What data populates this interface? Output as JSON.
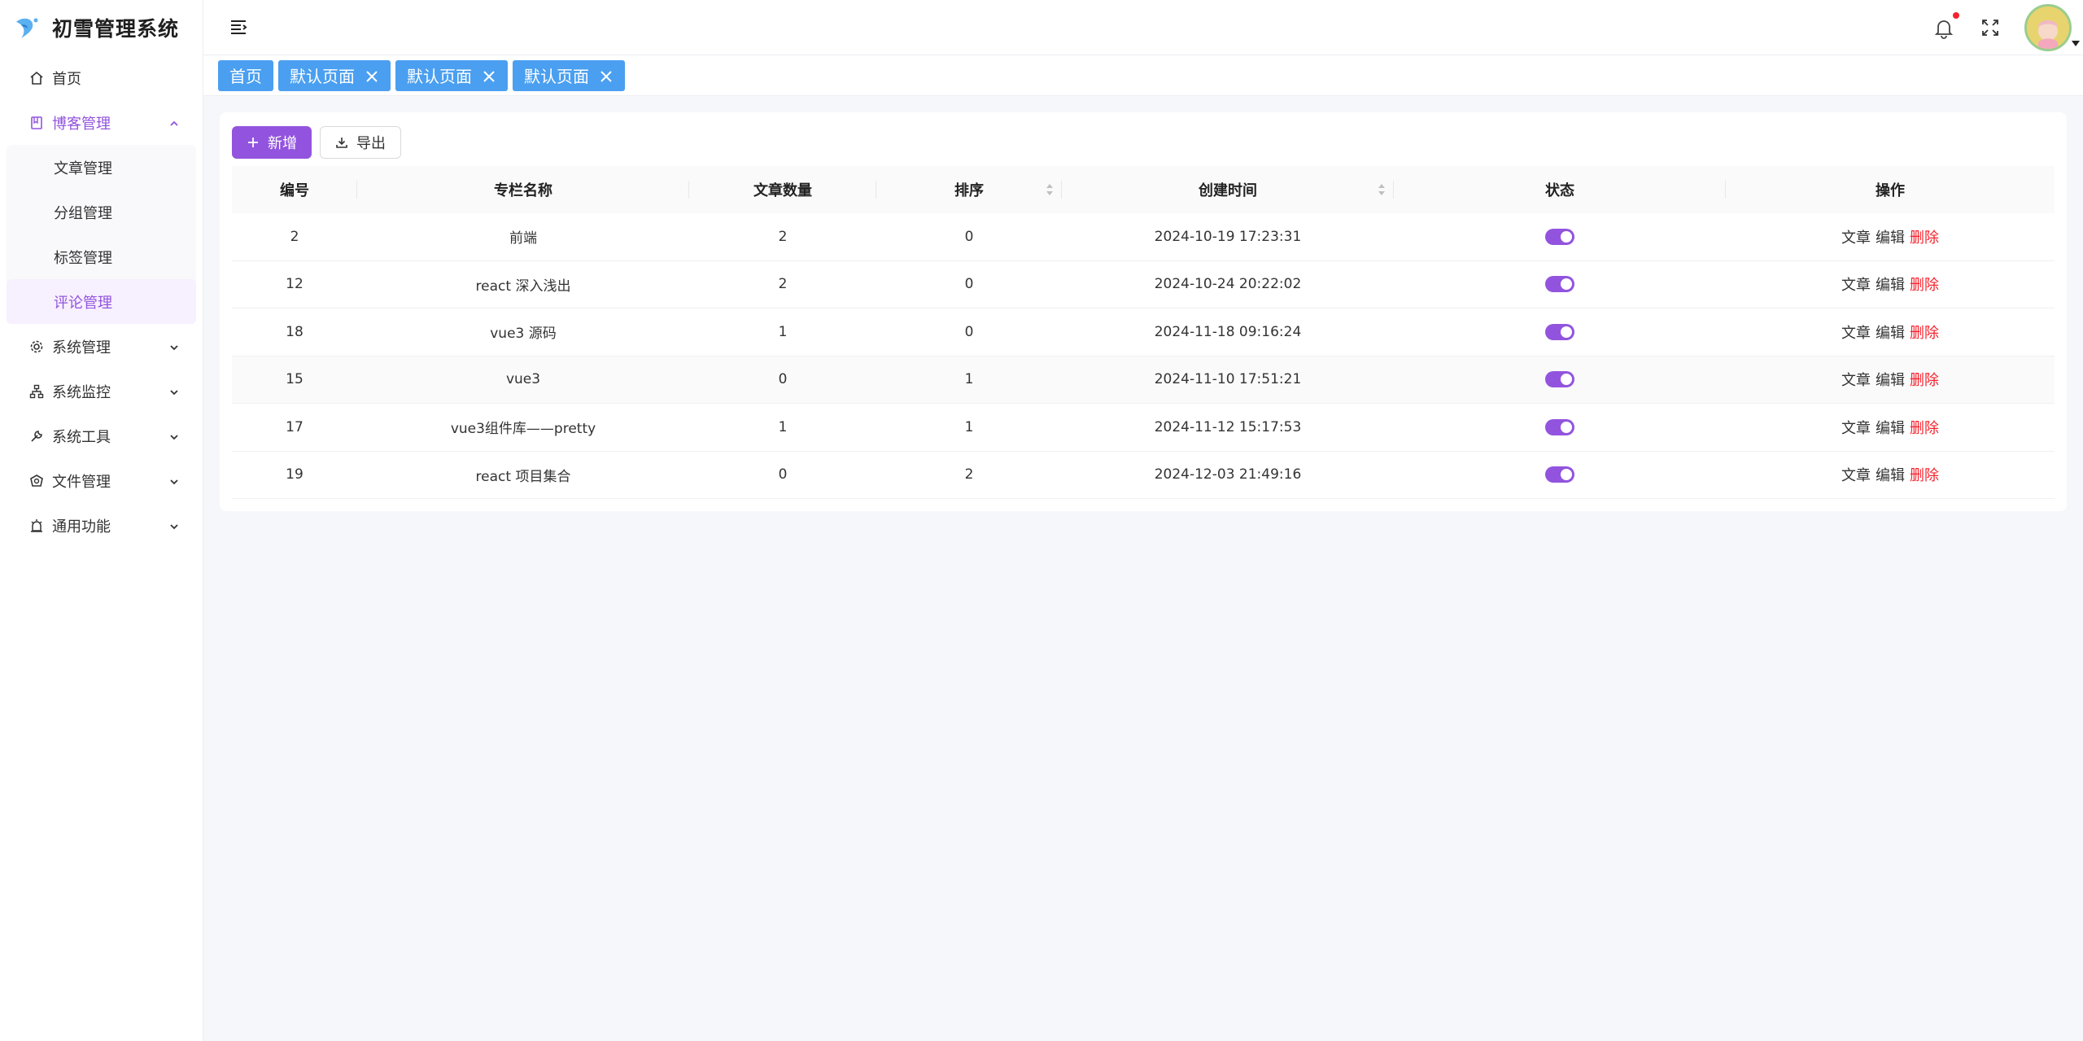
{
  "app": {
    "title": "初雪管理系统"
  },
  "sidebar": {
    "items": [
      {
        "label": "首页",
        "icon": "home-icon"
      },
      {
        "label": "博客管理",
        "icon": "book-icon",
        "expanded": true,
        "children": [
          {
            "label": "文章管理"
          },
          {
            "label": "分组管理"
          },
          {
            "label": "标签管理"
          },
          {
            "label": "评论管理",
            "active": true
          }
        ]
      },
      {
        "label": "系统管理",
        "icon": "gear-icon"
      },
      {
        "label": "系统监控",
        "icon": "network-icon"
      },
      {
        "label": "系统工具",
        "icon": "wrench-icon"
      },
      {
        "label": "文件管理",
        "icon": "folder-icon"
      },
      {
        "label": "通用功能",
        "icon": "alarm-icon"
      }
    ]
  },
  "tags": [
    {
      "label": "首页",
      "closable": false
    },
    {
      "label": "默认页面",
      "closable": true
    },
    {
      "label": "默认页面",
      "closable": true
    },
    {
      "label": "默认页面",
      "closable": true
    }
  ],
  "toolbar": {
    "add_label": "新增",
    "export_label": "导出"
  },
  "table": {
    "columns": [
      "编号",
      "专栏名称",
      "文章数量",
      "排序",
      "创建时间",
      "状态",
      "操作"
    ],
    "rows": [
      {
        "id": "2",
        "name": "前端",
        "count": "2",
        "sort": "0",
        "created": "2024-10-19 17:23:31",
        "status": true
      },
      {
        "id": "12",
        "name": "react 深入浅出",
        "count": "2",
        "sort": "0",
        "created": "2024-10-24 20:22:02",
        "status": true
      },
      {
        "id": "18",
        "name": "vue3 源码",
        "count": "1",
        "sort": "0",
        "created": "2024-11-18 09:16:24",
        "status": true
      },
      {
        "id": "15",
        "name": "vue3",
        "count": "0",
        "sort": "1",
        "created": "2024-11-10 17:51:21",
        "status": true
      },
      {
        "id": "17",
        "name": "vue3组件库——pretty",
        "count": "1",
        "sort": "1",
        "created": "2024-11-12 15:17:53",
        "status": true
      },
      {
        "id": "19",
        "name": "react 项目集合",
        "count": "0",
        "sort": "2",
        "created": "2024-12-03 21:49:16",
        "status": true
      }
    ],
    "actions": {
      "article": "文章",
      "edit": "编辑",
      "delete": "删除"
    }
  },
  "colors": {
    "primary": "#9254de",
    "tag_bg": "#4a9ff0",
    "danger": "#f5222d"
  }
}
